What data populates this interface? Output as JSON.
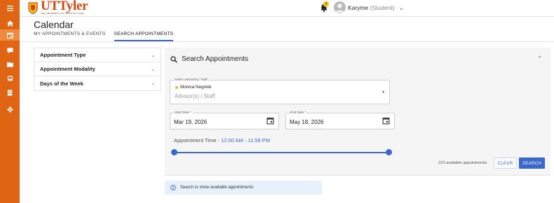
{
  "app": {
    "logo_text": "UTTyler",
    "logo_subtitle": "THE UNIVERSITY OF TEXAS AT TYLER"
  },
  "header": {
    "notification_count": "4",
    "user_name": "Karyme",
    "user_role": "(Student)"
  },
  "page": {
    "title": "Calendar",
    "tabs": [
      {
        "label": "MY APPOINTMENTS & EVENTS",
        "active": false
      },
      {
        "label": "SEARCH APPOINTMENTS",
        "active": true
      }
    ]
  },
  "filters": [
    {
      "label": "Appointment Type"
    },
    {
      "label": "Appointment Modality"
    },
    {
      "label": "Days of the Week"
    }
  ],
  "search": {
    "title": "Search Appointments",
    "advisor_label": "Select advisor(s) / staff",
    "advisor_selected": "Monica Negrete",
    "advisor_placeholder": "Advisor(s) / Staff",
    "start_date_label": "Start Date *",
    "start_date": "Mar 19, 2026",
    "end_date_label": "End Date *",
    "end_date": "May 18, 2026",
    "time_label": "Appointment Time - ",
    "time_value": "12:00 AM - 11:59 PM",
    "time_range_fraction": [
      0.0,
      1.0
    ],
    "available_text": "223 available appointments",
    "clear_label": "CLEAR",
    "search_label": "SEARCH"
  },
  "info_banner": {
    "text": "Search to show available appointments"
  },
  "colors": {
    "rail": "#df6514",
    "accent": "#3b67c9",
    "brand": "#cf4a12"
  }
}
